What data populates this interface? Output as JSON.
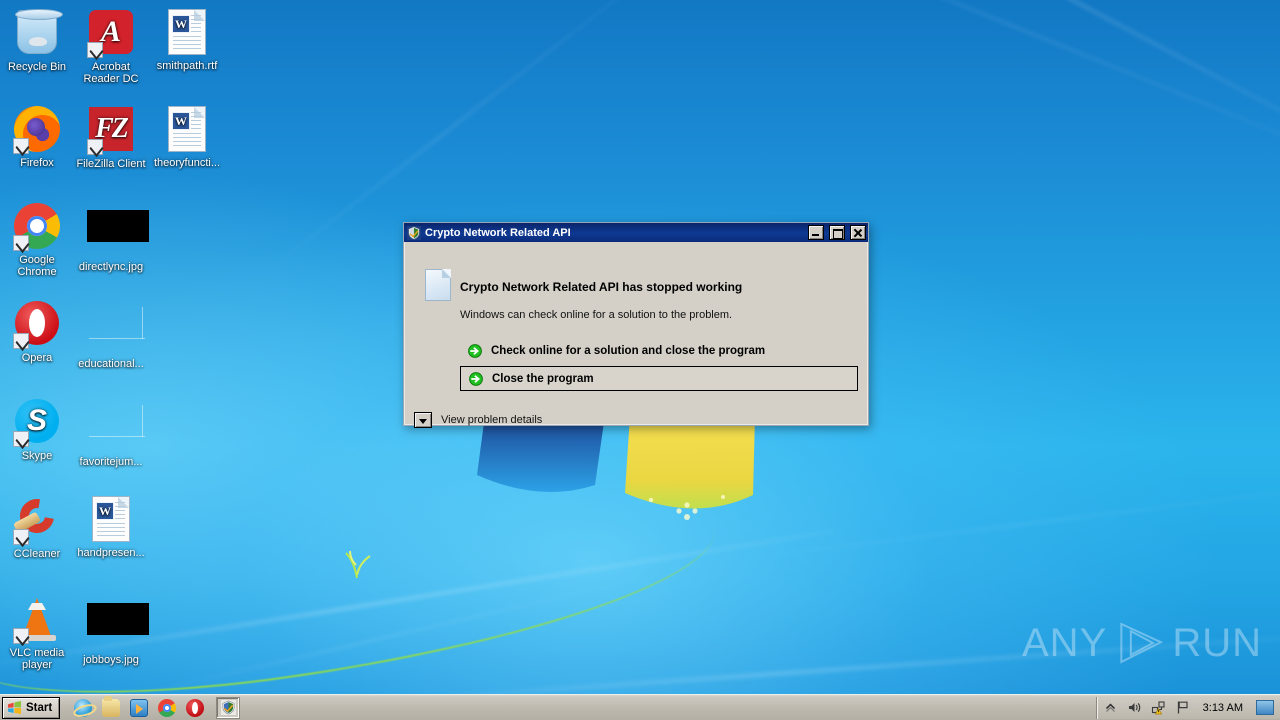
{
  "desktop": {
    "icons": [
      {
        "label": "Recycle Bin",
        "icon": "recycle-bin-icon",
        "shortcut": false
      },
      {
        "label": "Acrobat Reader DC",
        "icon": "acrobat-reader-icon",
        "shortcut": true
      },
      {
        "label": "smithpath.rtf",
        "icon": "word-document-icon",
        "shortcut": false
      },
      {
        "label": "Firefox",
        "icon": "firefox-icon",
        "shortcut": true
      },
      {
        "label": "FileZilla Client",
        "icon": "filezilla-icon",
        "shortcut": true
      },
      {
        "label": "theoryfuncti...",
        "icon": "word-document-icon",
        "shortcut": false
      },
      {
        "label": "Google Chrome",
        "icon": "chrome-icon",
        "shortcut": true
      },
      {
        "label": "directlync.jpg",
        "icon": "black-image-thumbnail",
        "shortcut": false
      },
      {
        "label": "Opera",
        "icon": "opera-icon",
        "shortcut": true
      },
      {
        "label": "educational...",
        "icon": "blank-document-icon",
        "shortcut": false
      },
      {
        "label": "Skype",
        "icon": "skype-icon",
        "shortcut": true
      },
      {
        "label": "favoritejum...",
        "icon": "blank-document-icon",
        "shortcut": false
      },
      {
        "label": "CCleaner",
        "icon": "ccleaner-icon",
        "shortcut": true
      },
      {
        "label": "handpresen...",
        "icon": "word-document-icon",
        "shortcut": false
      },
      {
        "label": "VLC media player",
        "icon": "vlc-icon",
        "shortcut": true
      },
      {
        "label": "jobboys.jpg",
        "icon": "black-image-thumbnail",
        "shortcut": false
      }
    ],
    "watermark": {
      "text_left": "ANY",
      "text_right": "RUN"
    }
  },
  "dialog": {
    "title": "Crypto Network Related API",
    "headline": "Crypto Network Related API has stopped working",
    "subline": "Windows can check online for a solution to the problem.",
    "actions": [
      {
        "label": "Check online for a solution and close the program",
        "framed": false
      },
      {
        "label": "Close the program",
        "framed": true
      }
    ],
    "details_label": "View problem details",
    "buttons": {
      "minimize": "Minimize",
      "maximize": "Maximize",
      "close": "Close"
    },
    "colors": {
      "titlebar": "#0a246a",
      "face": "#d4d0c8",
      "arrow": "#17b317"
    }
  },
  "taskbar": {
    "start_label": "Start",
    "quicklaunch": [
      {
        "name": "internet-explorer-icon"
      },
      {
        "name": "windows-explorer-icon"
      },
      {
        "name": "windows-media-player-icon"
      },
      {
        "name": "chrome-icon"
      },
      {
        "name": "opera-icon"
      }
    ],
    "active_task": {
      "name": "crypto-network-related-api-task"
    },
    "tray": [
      {
        "name": "show-hidden-icons-icon"
      },
      {
        "name": "volume-icon"
      },
      {
        "name": "network-warning-icon"
      },
      {
        "name": "action-center-flag-icon"
      }
    ],
    "clock": "3:13 AM",
    "show_desktop": "Show desktop"
  }
}
